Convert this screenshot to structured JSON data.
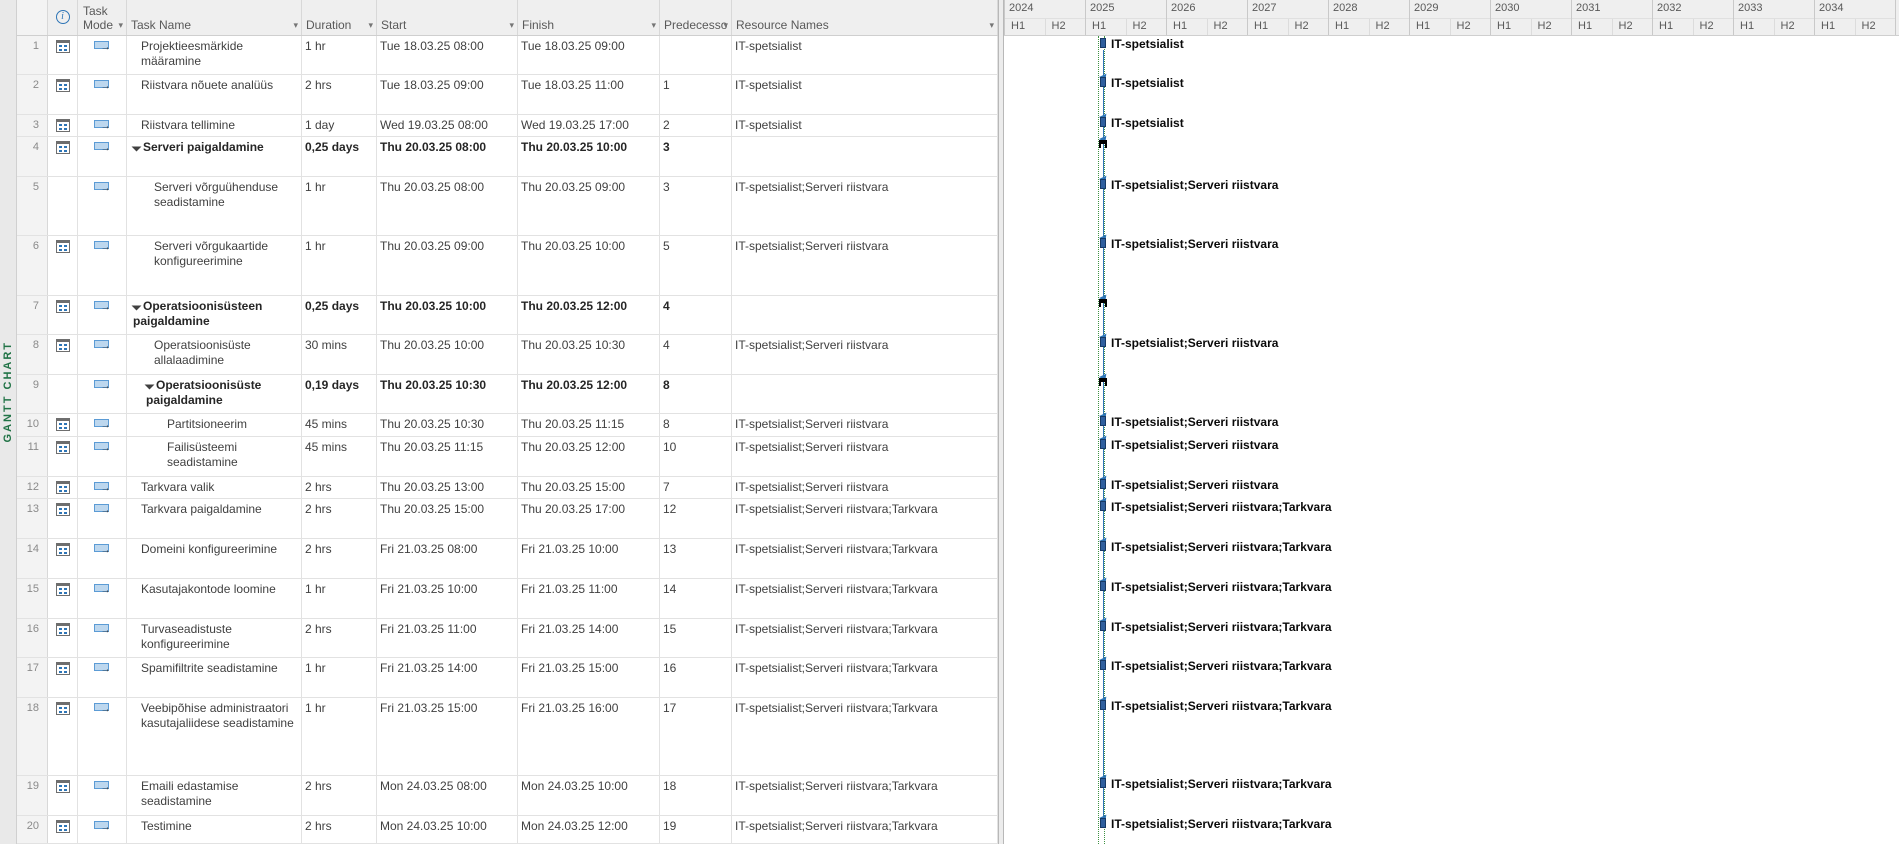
{
  "view": {
    "label": "GANTT CHART"
  },
  "colors": {
    "view_label_green": "#217346",
    "bar_blue": "#2f5f9e",
    "link_blue": "#2e75b6",
    "current_date_green": "#3f9142",
    "summary_black": "#000000"
  },
  "table": {
    "columns": [
      {
        "id": "rownum",
        "label": ""
      },
      {
        "id": "info",
        "label": "",
        "icon": "info-icon"
      },
      {
        "id": "mode",
        "label": "Task Mode"
      },
      {
        "id": "name",
        "label": "Task Name"
      },
      {
        "id": "duration",
        "label": "Duration"
      },
      {
        "id": "start",
        "label": "Start"
      },
      {
        "id": "finish",
        "label": "Finish"
      },
      {
        "id": "pred",
        "label": "Predecesso"
      },
      {
        "id": "resources",
        "label": "Resource Names"
      }
    ]
  },
  "timeline": {
    "years": [
      "2024",
      "2025",
      "2026",
      "2027",
      "2028",
      "2029",
      "2030",
      "2031",
      "2032",
      "2033",
      "2034"
    ],
    "half1": "H1",
    "half2": "H2"
  },
  "tasks": [
    {
      "id": 1,
      "info": true,
      "level": 0,
      "summary": false,
      "name": "Projektieesmärkide määramine",
      "duration": "1 hr",
      "start": "Tue 18.03.25 08:00",
      "finish": "Tue 18.03.25 09:00",
      "pred": "",
      "resources": "IT-spetsialist",
      "bar_label": "IT-spetsialist"
    },
    {
      "id": 2,
      "info": true,
      "level": 0,
      "summary": false,
      "name": "Riistvara nõuete analüüs",
      "duration": "2 hrs",
      "start": "Tue 18.03.25 09:00",
      "finish": "Tue 18.03.25 11:00",
      "pred": "1",
      "resources": "IT-spetsialist",
      "bar_label": "IT-spetsialist"
    },
    {
      "id": 3,
      "info": true,
      "level": 0,
      "summary": false,
      "name": "Riistvara tellimine",
      "duration": "1 day",
      "start": "Wed 19.03.25 08:00",
      "finish": "Wed 19.03.25 17:00",
      "pred": "2",
      "resources": "IT-spetsialist",
      "bar_label": "IT-spetsialist"
    },
    {
      "id": 4,
      "info": true,
      "level": 0,
      "summary": true,
      "name": "Serveri paigaldamine",
      "duration": "0,25 days",
      "start": "Thu 20.03.25 08:00",
      "finish": "Thu 20.03.25 10:00",
      "pred": "3",
      "resources": "",
      "bar_label": ""
    },
    {
      "id": 5,
      "info": false,
      "level": 1,
      "summary": false,
      "name": "Serveri võrguühenduse seadistamine",
      "duration": "1 hr",
      "start": "Thu 20.03.25 08:00",
      "finish": "Thu 20.03.25 09:00",
      "pred": "3",
      "resources": "IT-spetsialist;Serveri riistvara",
      "bar_label": "IT-spetsialist;Serveri riistvara"
    },
    {
      "id": 6,
      "info": true,
      "level": 1,
      "summary": false,
      "name": "Serveri võrgukaartide konfigureerimine",
      "duration": "1 hr",
      "start": "Thu 20.03.25 09:00",
      "finish": "Thu 20.03.25 10:00",
      "pred": "5",
      "resources": "IT-spetsialist;Serveri riistvara",
      "bar_label": "IT-spetsialist;Serveri riistvara"
    },
    {
      "id": 7,
      "info": true,
      "level": 0,
      "summary": true,
      "name": "Operatsioonisüsteen paigaldamine",
      "duration": "0,25 days",
      "start": "Thu 20.03.25 10:00",
      "finish": "Thu 20.03.25 12:00",
      "pred": "4",
      "resources": "",
      "bar_label": ""
    },
    {
      "id": 8,
      "info": true,
      "level": 1,
      "summary": false,
      "name": "Operatsioonisüste allalaadimine",
      "duration": "30 mins",
      "start": "Thu 20.03.25 10:00",
      "finish": "Thu 20.03.25 10:30",
      "pred": "4",
      "resources": "IT-spetsialist;Serveri riistvara",
      "bar_label": "IT-spetsialist;Serveri riistvara"
    },
    {
      "id": 9,
      "info": false,
      "level": 1,
      "summary": true,
      "name": "Operatsioonisüste paigaldamine",
      "duration": "0,19 days",
      "start": "Thu 20.03.25 10:30",
      "finish": "Thu 20.03.25 12:00",
      "pred": "8",
      "resources": "",
      "bar_label": ""
    },
    {
      "id": 10,
      "info": true,
      "level": 2,
      "summary": false,
      "name": "Partitsioneerim",
      "duration": "45 mins",
      "start": "Thu 20.03.25 10:30",
      "finish": "Thu 20.03.25 11:15",
      "pred": "8",
      "resources": "IT-spetsialist;Serveri riistvara",
      "bar_label": "IT-spetsialist;Serveri riistvara"
    },
    {
      "id": 11,
      "info": true,
      "level": 2,
      "summary": false,
      "name": "Failisüsteemi seadistamine",
      "duration": "45 mins",
      "start": "Thu 20.03.25 11:15",
      "finish": "Thu 20.03.25 12:00",
      "pred": "10",
      "resources": "IT-spetsialist;Serveri riistvara",
      "bar_label": "IT-spetsialist;Serveri riistvara"
    },
    {
      "id": 12,
      "info": true,
      "level": 0,
      "summary": false,
      "name": "Tarkvara valik",
      "duration": "2 hrs",
      "start": "Thu 20.03.25 13:00",
      "finish": "Thu 20.03.25 15:00",
      "pred": "7",
      "resources": "IT-spetsialist;Serveri riistvara",
      "bar_label": "IT-spetsialist;Serveri riistvara"
    },
    {
      "id": 13,
      "info": true,
      "level": 0,
      "summary": false,
      "name": "Tarkvara paigaldamine",
      "duration": "2 hrs",
      "start": "Thu 20.03.25 15:00",
      "finish": "Thu 20.03.25 17:00",
      "pred": "12",
      "resources": "IT-spetsialist;Serveri riistvara;Tarkvara",
      "bar_label": "IT-spetsialist;Serveri riistvara;Tarkvara"
    },
    {
      "id": 14,
      "info": true,
      "level": 0,
      "summary": false,
      "name": "Domeini konfigureerimine",
      "duration": "2 hrs",
      "start": "Fri 21.03.25 08:00",
      "finish": "Fri 21.03.25 10:00",
      "pred": "13",
      "resources": "IT-spetsialist;Serveri riistvara;Tarkvara",
      "bar_label": "IT-spetsialist;Serveri riistvara;Tarkvara"
    },
    {
      "id": 15,
      "info": true,
      "level": 0,
      "summary": false,
      "name": "Kasutajakontode loomine",
      "duration": "1 hr",
      "start": "Fri 21.03.25 10:00",
      "finish": "Fri 21.03.25 11:00",
      "pred": "14",
      "resources": "IT-spetsialist;Serveri riistvara;Tarkvara",
      "bar_label": "IT-spetsialist;Serveri riistvara;Tarkvara"
    },
    {
      "id": 16,
      "info": true,
      "level": 0,
      "summary": false,
      "name": "Turvaseadistuste konfigureerimine",
      "duration": "2 hrs",
      "start": "Fri 21.03.25 11:00",
      "finish": "Fri 21.03.25 14:00",
      "pred": "15",
      "resources": "IT-spetsialist;Serveri riistvara;Tarkvara",
      "bar_label": "IT-spetsialist;Serveri riistvara;Tarkvara"
    },
    {
      "id": 17,
      "info": true,
      "level": 0,
      "summary": false,
      "name": "Spamifiltrite seadistamine",
      "duration": "1 hr",
      "start": "Fri 21.03.25 14:00",
      "finish": "Fri 21.03.25 15:00",
      "pred": "16",
      "resources": "IT-spetsialist;Serveri riistvara;Tarkvara",
      "bar_label": "IT-spetsialist;Serveri riistvara;Tarkvara"
    },
    {
      "id": 18,
      "info": true,
      "level": 0,
      "summary": false,
      "name": "Veebipõhise administraatori kasutajaliidese seadistamine",
      "duration": "1 hr",
      "start": "Fri 21.03.25 15:00",
      "finish": "Fri 21.03.25 16:00",
      "pred": "17",
      "resources": "IT-spetsialist;Serveri riistvara;Tarkvara",
      "bar_label": "IT-spetsialist;Serveri riistvara;Tarkvara"
    },
    {
      "id": 19,
      "info": true,
      "level": 0,
      "summary": false,
      "name": "Emaili edastamise seadistamine",
      "duration": "2 hrs",
      "start": "Mon 24.03.25 08:00",
      "finish": "Mon 24.03.25 10:00",
      "pred": "18",
      "resources": "IT-spetsialist;Serveri riistvara;Tarkvara",
      "bar_label": "IT-spetsialist;Serveri riistvara;Tarkvara"
    },
    {
      "id": 20,
      "info": true,
      "level": 0,
      "summary": false,
      "name": "Testimine",
      "duration": "2 hrs",
      "start": "Mon 24.03.25 10:00",
      "finish": "Mon 24.03.25 12:00",
      "pred": "19",
      "resources": "IT-spetsialist;Serveri riistvara;Tarkvara",
      "bar_label": "IT-spetsialist;Serveri riistvara;Tarkvara"
    }
  ]
}
